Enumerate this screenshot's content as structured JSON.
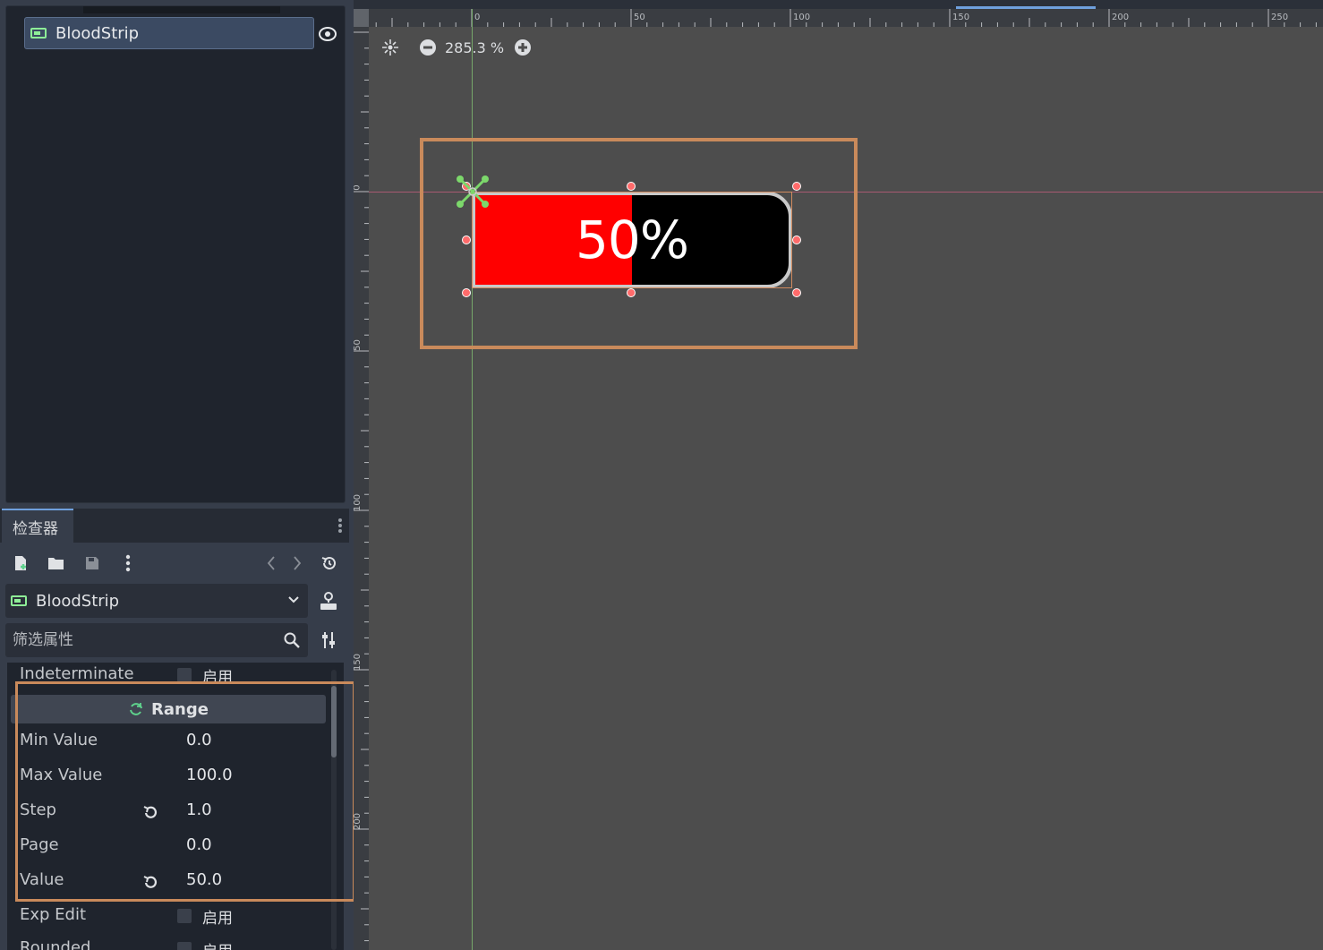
{
  "scene_tree": {
    "node_label": "BloodStrip"
  },
  "inspector": {
    "tab_label": "检查器",
    "object_label": "BloodStrip",
    "filter_placeholder": "筛选属性",
    "properties": {
      "indeterminate": {
        "name": "Indeterminate",
        "check_label": "启用"
      },
      "range_header": "Range",
      "min_value": {
        "name": "Min Value",
        "value": "0.0"
      },
      "max_value": {
        "name": "Max Value",
        "value": "100.0"
      },
      "step": {
        "name": "Step",
        "value": "1.0"
      },
      "page": {
        "name": "Page",
        "value": "0.0"
      },
      "value": {
        "name": "Value",
        "value": "50.0"
      },
      "exp_edit": {
        "name": "Exp Edit",
        "check_label": "启用"
      },
      "rounded": {
        "name": "Rounded",
        "check_label": "启用"
      }
    }
  },
  "viewport": {
    "zoom_level": "285.3 %",
    "ruler_top_labels": [
      "0",
      "50",
      "100",
      "150",
      "200",
      "250"
    ],
    "ruler_left_labels": [
      "0",
      "50",
      "100",
      "150",
      "200"
    ],
    "progress": {
      "value": 50,
      "min": 0,
      "max": 100,
      "text": "50%",
      "fill_color": "#ff0000",
      "background_color": "#000000",
      "border_color": "#c9c9c9"
    }
  },
  "colors": {
    "highlight_box": "#c98a5b",
    "accent": "#6fa0dd",
    "node_icon": "#8eef97"
  }
}
